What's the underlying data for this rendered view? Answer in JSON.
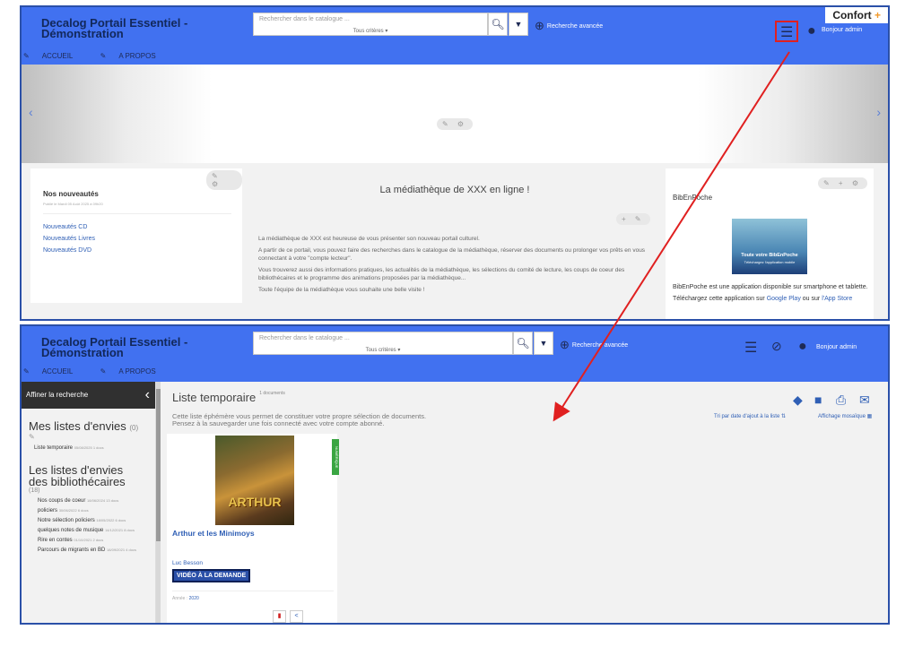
{
  "colors": {
    "header": "#4171f0",
    "accent": "#2f5fb5",
    "annotation": "#e02020",
    "badge": "#3aa542"
  },
  "site": {
    "title_line1": "Decalog Portail Essentiel -",
    "title_line2": "Démonstration"
  },
  "search": {
    "placeholder": "Rechercher dans le catalogue ...",
    "criteria": "Tous critères",
    "advanced": "Recherche avancée"
  },
  "header": {
    "greeting": "Bonjour admin",
    "confort_label": "Confort"
  },
  "nav": {
    "accueil": "ACCUEIL",
    "apropos": "A PROPOS"
  },
  "home": {
    "news": {
      "title": "Nos nouveautés",
      "posted": "Publié le Mardi 05 Août 2025 à 09h20",
      "links": [
        "Nouveautés CD",
        "Nouveautés Livres",
        "Nouveautés DVD"
      ]
    },
    "center": {
      "title": "La médiathèque de XXX en ligne !",
      "p1": "La médiathèque de XXX est heureuse de vous présenter son nouveau portail culturel.",
      "p2": "A partir de ce portail, vous pouvez faire des recherches dans le catalogue de la médiathèque, réserver des documents ou prolonger vos prêts en vous connectant à votre \"compte lecteur\".",
      "p3": "Vous trouverez aussi des informations pratiques, les actualités de la médiathèque, les sélections du comité de lecture, les coups de coeur des bibliothécaires et le programme des animations proposées par la médiathèque...",
      "p4": "Toute l'équipe de la médiathèque vous souhaite une belle visite !"
    },
    "bibenpoche": {
      "title": "BibEnPoche",
      "banner_line1": "Toute votre BibEnPoche",
      "banner_line2": "Téléchargez l'application mobile",
      "text1": "BibEnPoche est une application disponible sur smartphone et tablette.",
      "text2_prefix": "Téléchargez cette application sur",
      "google_play": "Google Play",
      "or": "ou sur",
      "app_store": "l'App Store"
    }
  },
  "sidebar": {
    "refine": "Affiner la recherche",
    "my_lists_title": "Mes listes d'envies",
    "my_lists_count": "(0)",
    "temp_list": "Liste temporaire",
    "temp_list_meta": "05/08/2025 1 docs",
    "lib_lists_title_1": "Les listes d'envies",
    "lib_lists_title_2": "des bibliothécaires",
    "lib_lists_count": "(18)",
    "items": [
      {
        "label": "Nos coups de coeur",
        "meta": "18/06/2024 13 docs"
      },
      {
        "label": "policiers",
        "meta": "30/06/2022 6 docs"
      },
      {
        "label": "Notre sélection policiers",
        "meta": "18/05/2022 6 docs"
      },
      {
        "label": "quelques notes de musique",
        "meta": "14/12/2021 8 docs"
      },
      {
        "label": "Rire en contes",
        "meta": "01/10/2021 2 docs"
      },
      {
        "label": "Parcours de migrants en BD",
        "meta": "18/09/2021 4 docs"
      }
    ]
  },
  "list": {
    "title": "Liste temporaire",
    "count": "1 documents",
    "desc_line1": "Cette liste éphémère vous permet de constituer votre propre sélection de documents.",
    "desc_line2": "Pensez à la sauvegarder une fois connecté avec votre compte abonné.",
    "sort": "Tri par date d'ajout à la liste",
    "display": "Affichage mosaïque"
  },
  "doc": {
    "badge": "NUMÉRIQUE",
    "cover_text": "ARTHUR",
    "title": "Arthur et les Minimoys",
    "author": "Luc Besson",
    "type": "VIDÉO À LA DEMANDE",
    "year_label": "Année :",
    "year": "2020"
  }
}
